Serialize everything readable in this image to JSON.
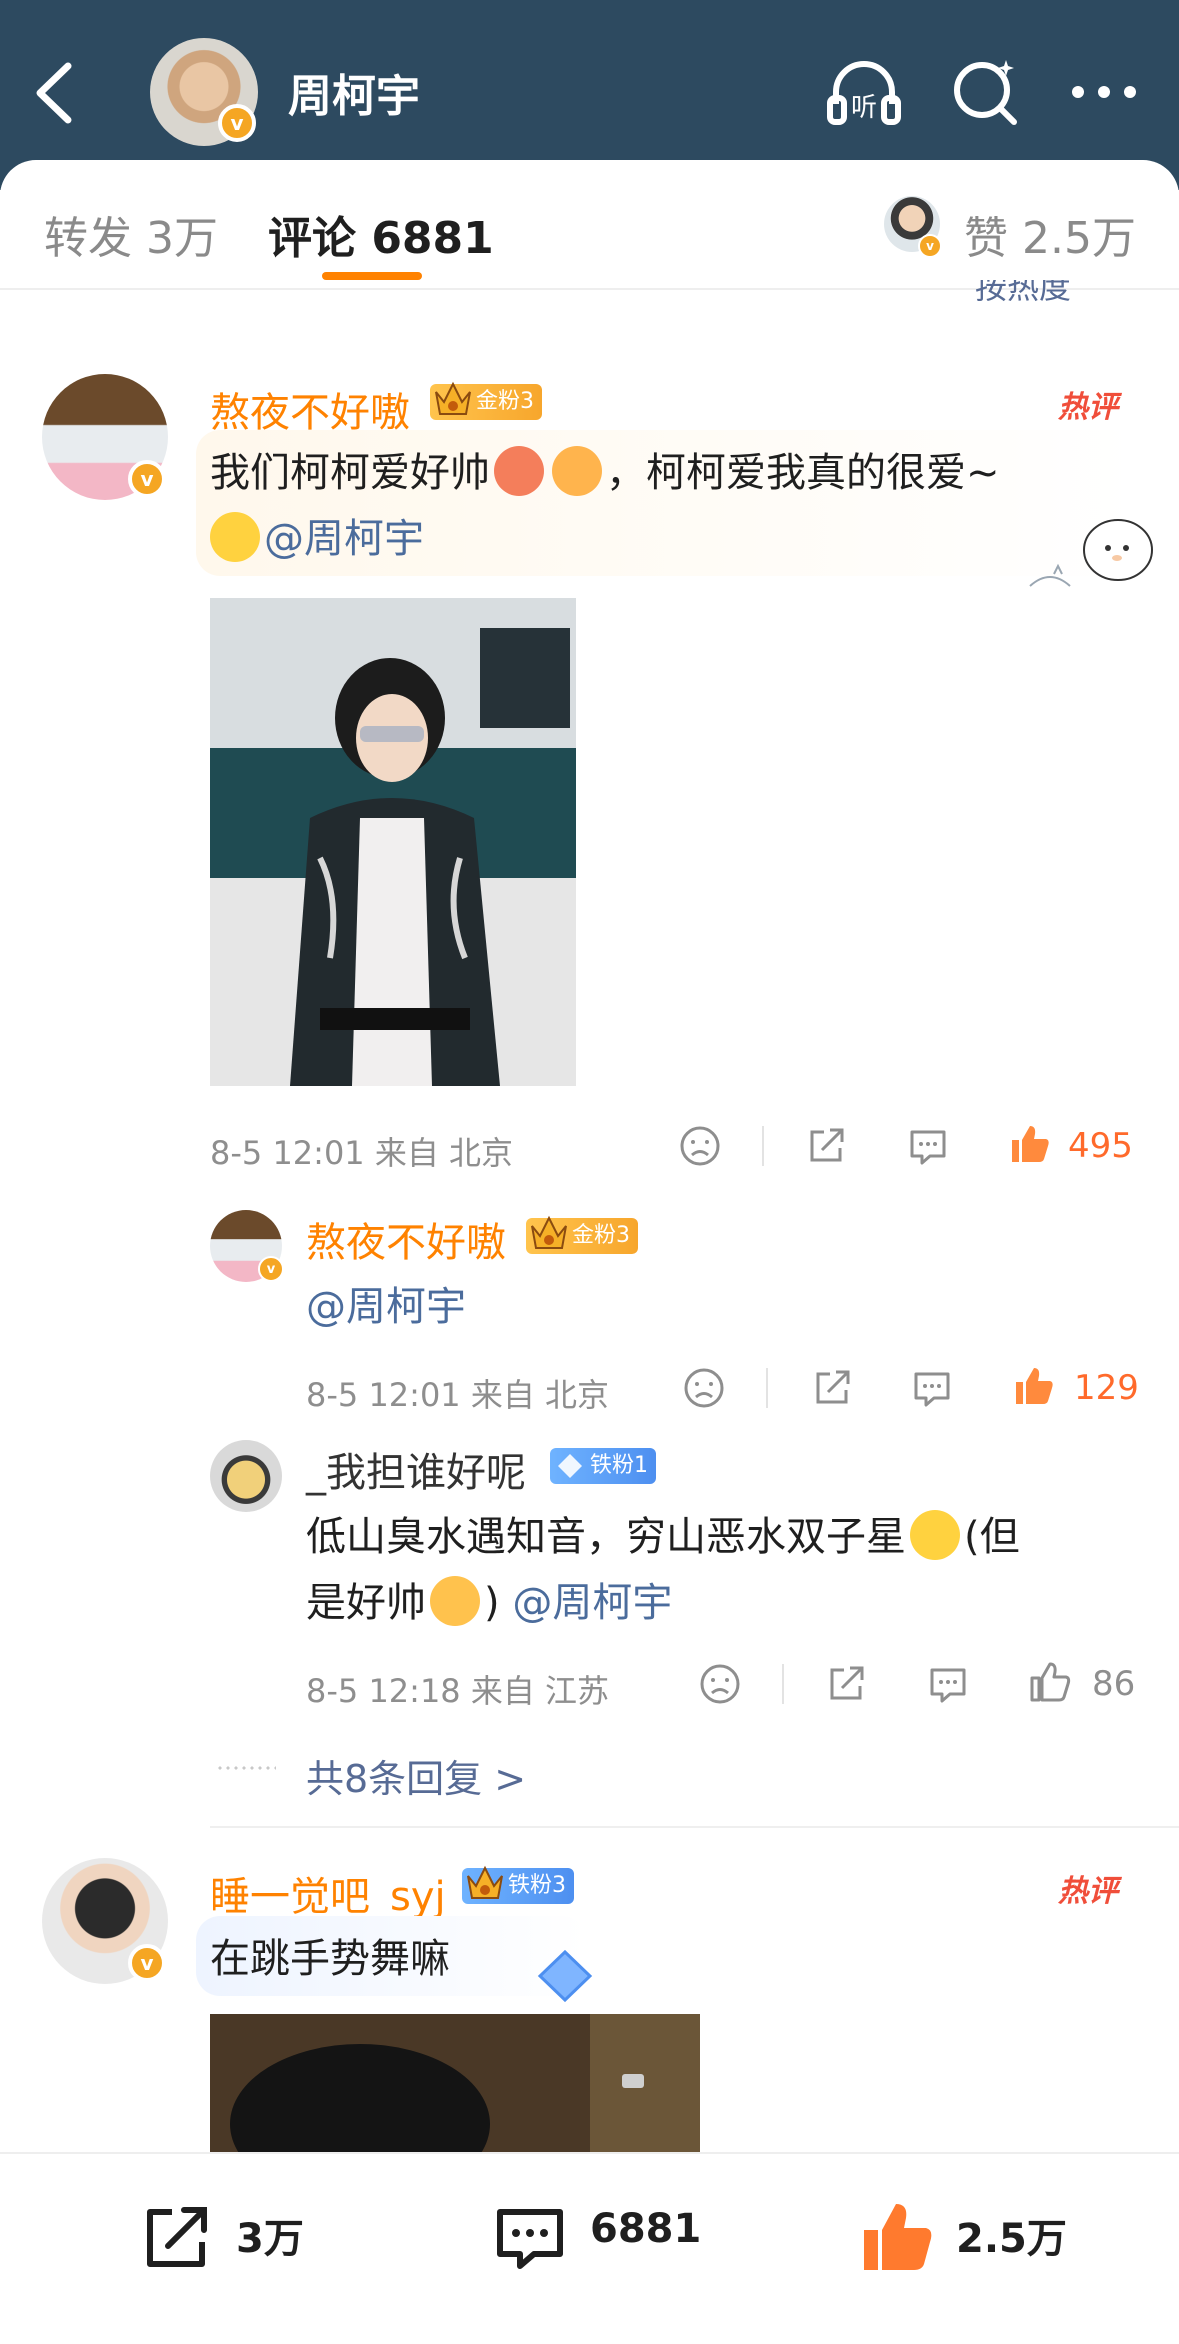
{
  "header": {
    "title": "周柯宇"
  },
  "tabs": {
    "repost_label": "转发 3万",
    "comment_label": "评论 6881",
    "like_label": "赞 2.5万",
    "sort_label": "按热度"
  },
  "comments": [
    {
      "user": "熬夜不好嗷",
      "fan_badge": "金粉3",
      "hot_label": "热评",
      "text_before": "我们柯柯爱好帅",
      "text_middle": "，柯柯爱我真的很爱~",
      "mention": "@周柯宇",
      "date": "8-5 12:01",
      "source": "来自 北京",
      "likes": "495",
      "replies": [
        {
          "user": "熬夜不好嗷",
          "fan_badge": "金粉3",
          "mention": "@周柯宇",
          "date": "8-5 12:01",
          "source": "来自 北京",
          "likes": "129"
        },
        {
          "user": "_我担谁好呢",
          "fan_badge": "铁粉1",
          "text_line1": "低山臭水遇知音，穷山恶水双子星",
          "text_line1_tail": "(但",
          "text_line2_a": "是好帅",
          "text_line2_b": ") ",
          "mention": "@周柯宇",
          "date": "8-5 12:18",
          "source": "来自 江苏",
          "likes": "86"
        }
      ],
      "more_replies": "共8条回复 >"
    },
    {
      "user": "睡一觉吧_syj",
      "fan_badge": "铁粉3",
      "hot_label": "热评",
      "text": "在跳手势舞嘛"
    }
  ],
  "bottom_bar": {
    "repost_count": "3万",
    "comment_count": "6881",
    "like_count": "2.5万"
  },
  "colors": {
    "header_bg": "#2d4a60",
    "accent": "#ff8200",
    "like": "#ff6a2b",
    "mention": "#4b6c9c",
    "hot": "#f04e3a"
  },
  "icons": [
    "back-icon",
    "listen-icon",
    "search-icon",
    "more-icon",
    "dislike-icon",
    "share-icon",
    "comment-icon",
    "like-icon",
    "crown-icon",
    "verified-icon"
  ]
}
